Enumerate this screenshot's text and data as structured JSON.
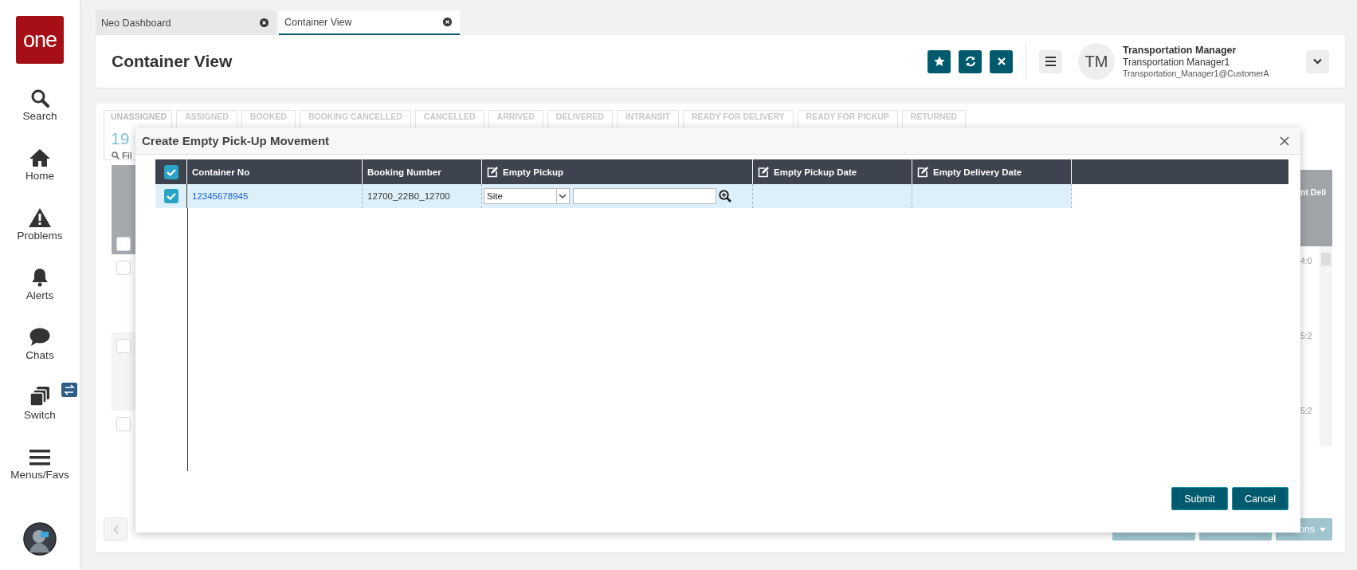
{
  "app_tabs": [
    {
      "label": "Neo Dashboard",
      "selected": false
    },
    {
      "label": "Container View",
      "selected": true
    }
  ],
  "sidebar": {
    "logo": "one",
    "items": [
      {
        "label": "Search",
        "kind": "search"
      },
      {
        "label": "Home",
        "kind": "home"
      },
      {
        "label": "Problems",
        "kind": "warning"
      },
      {
        "label": "Alerts",
        "kind": "bell"
      },
      {
        "label": "Chats",
        "kind": "chat"
      },
      {
        "label": "Switch",
        "kind": "switch"
      },
      {
        "label": "Menus/Favs",
        "kind": "menu"
      }
    ]
  },
  "header": {
    "title": "Container View",
    "user": {
      "initials": "TM",
      "name": "Transportation Manager",
      "role": "Transportation Manager1",
      "account": "Transportation_Manager1@CustomerA"
    }
  },
  "background": {
    "status_tabs": [
      {
        "label": "UNASSIGNED",
        "count": "19",
        "selected": true
      },
      {
        "label": "ASSIGNED",
        "selected": false
      },
      {
        "label": "BOOKED",
        "selected": false
      },
      {
        "label": "BOOKING CANCELLED",
        "selected": false
      },
      {
        "label": "CANCELLED",
        "selected": false
      },
      {
        "label": "ARRIVED",
        "selected": false
      },
      {
        "label": "DELIVERED",
        "selected": false
      },
      {
        "label": "INTRANSIT",
        "selected": false
      },
      {
        "label": "READY FOR DELIVERY",
        "selected": false
      },
      {
        "label": "READY FOR PICKUP",
        "selected": false
      },
      {
        "label": "RETURNED",
        "selected": false
      }
    ],
    "filter": "Fil",
    "grid_checkboxes": [
      {
        "checked": false
      },
      {
        "checked": false
      },
      {
        "checked": false
      },
      {
        "checked": false
      }
    ],
    "column_header": "nt Deli",
    "times": [
      "4:0",
      "5:2",
      "5:2"
    ],
    "action_button": "ons"
  },
  "dialog": {
    "title": "Create Empty Pick-Up Movement",
    "select_all": true,
    "columns": [
      {
        "label": "Container No",
        "editable": false
      },
      {
        "label": "Booking Number",
        "editable": false
      },
      {
        "label": "Empty Pickup",
        "editable": true
      },
      {
        "label": "Empty Pickup Date",
        "editable": true
      },
      {
        "label": "Empty Delivery Date",
        "editable": true
      }
    ],
    "rows": [
      {
        "checked": true,
        "container_no": "12345678945",
        "booking_number": "12700_22B0_12700",
        "pickup_type": "Site"
      }
    ],
    "buttons": [
      "Submit",
      "Cancel"
    ]
  }
}
